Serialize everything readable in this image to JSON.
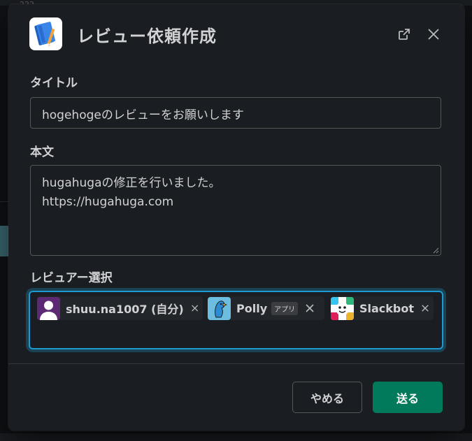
{
  "background": {
    "ghost_text": "222"
  },
  "modal": {
    "title": "レビュー依頼作成",
    "app_icon": "notebook-icon",
    "open_icon": "external-link-icon",
    "close_icon": "close-icon"
  },
  "form": {
    "title_label": "タイトル",
    "title_value": "hogehogeのレビューをお願いします",
    "body_label": "本文",
    "body_lines": [
      "hugahugaの修正を行いました。",
      "https://hugahuga.com"
    ],
    "reviewer_label": "レビュアー選択",
    "reviewers": [
      {
        "name": "shuu.na1007 (自分)",
        "avatar": "default-user-avatar"
      },
      {
        "name": "Polly",
        "badge": "アプリ",
        "avatar": "polly-bird-avatar"
      },
      {
        "name": "Slackbot",
        "avatar": "slackbot-avatar"
      }
    ]
  },
  "footer": {
    "cancel_label": "やめる",
    "submit_label": "送る"
  },
  "colors": {
    "accent_focus": "#1d9bd1",
    "submit_green": "#007a5a",
    "modal_bg": "#1a1d21"
  }
}
